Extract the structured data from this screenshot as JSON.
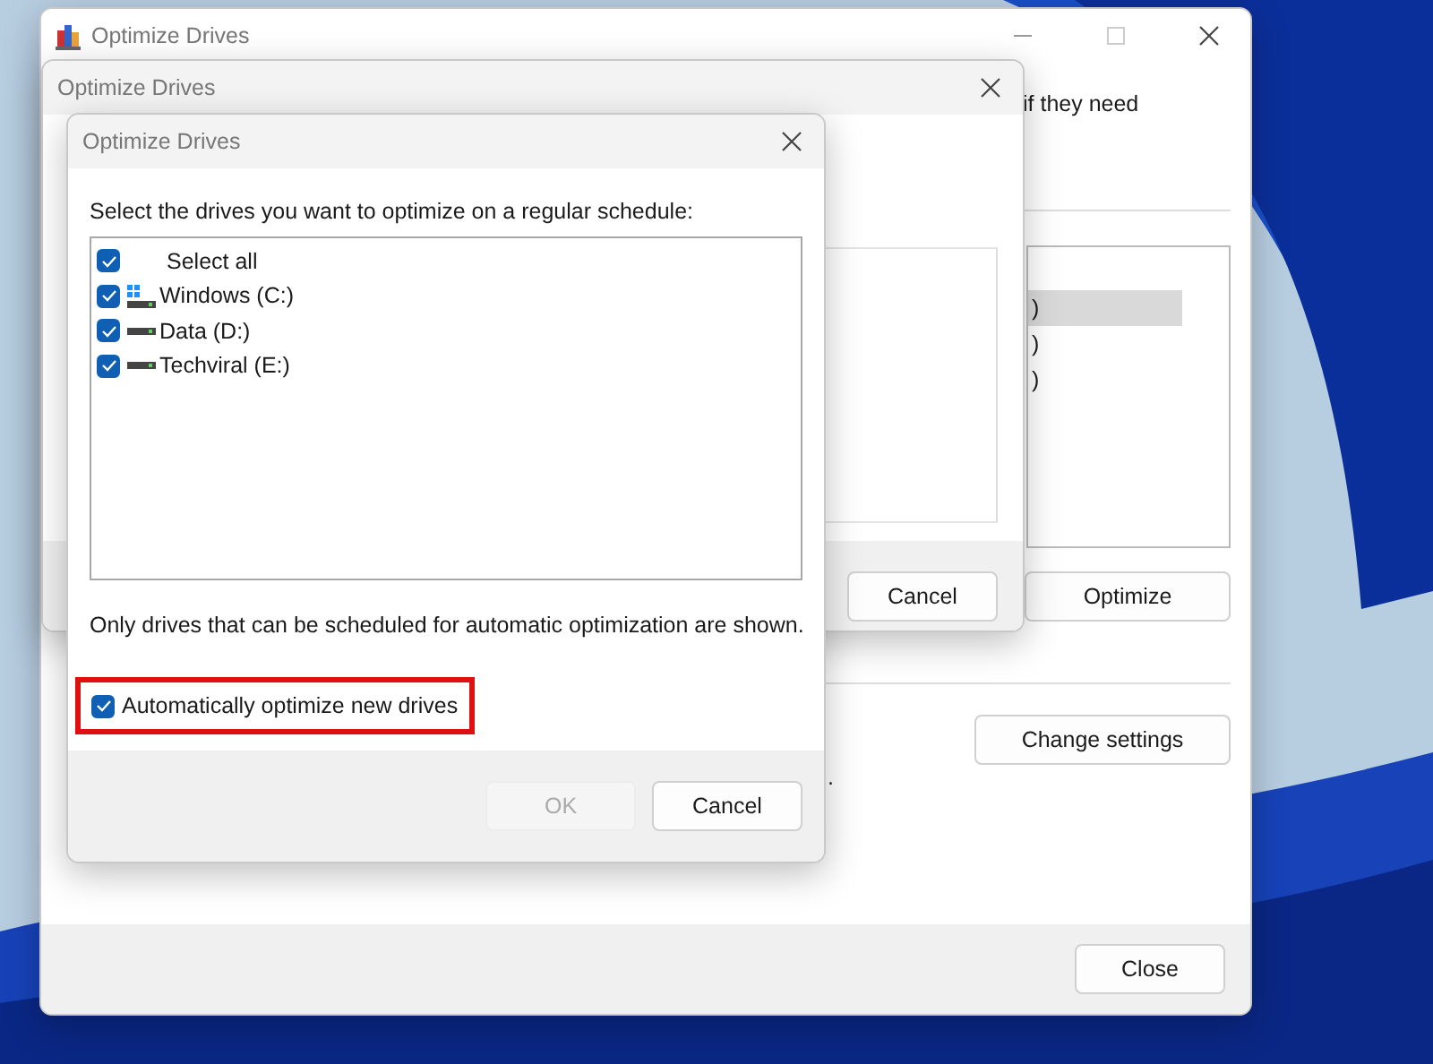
{
  "windows": [
    {
      "kind": "main",
      "title": "Optimize Drives",
      "intro_fragment": "if they need",
      "drive_rows": [
        {
          "text": ")",
          "selected": true
        },
        {
          "text": ")",
          "selected": false
        },
        {
          "text": ")",
          "selected": false
        }
      ],
      "optimize_button": "Optimize",
      "change_settings_button": "Change settings",
      "status_fragment": ".",
      "close_button": "Close"
    },
    {
      "kind": "schedule",
      "title": "Optimize Drives",
      "cancel_button": "Cancel"
    },
    {
      "kind": "select",
      "title": "Optimize Drives",
      "instruction": "Select the drives you want to optimize on a regular schedule:",
      "drives": [
        {
          "label": "Select all",
          "kind": "all",
          "checked": true
        },
        {
          "label": "Windows (C:)",
          "kind": "system",
          "checked": true
        },
        {
          "label": "Data (D:)",
          "kind": "disk",
          "checked": true
        },
        {
          "label": "Techviral (E:)",
          "kind": "disk",
          "checked": true
        }
      ],
      "note": "Only drives that can be scheduled for automatic optimization are shown.",
      "auto_optimize": {
        "label": "Automatically optimize new drives",
        "checked": true,
        "highlighted": true
      },
      "ok_button": {
        "label": "OK",
        "disabled": true
      },
      "cancel_button": "Cancel"
    }
  ]
}
